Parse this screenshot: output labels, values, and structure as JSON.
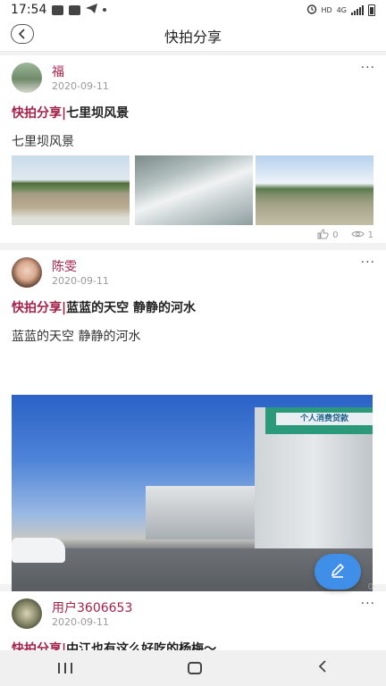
{
  "status_bar": {
    "time": "17:54",
    "network": "4G",
    "hd": "HD"
  },
  "header": {
    "title": "快拍分享"
  },
  "posts": [
    {
      "author": "福",
      "date": "2020-09-11",
      "tag": "快拍分享|",
      "title": "七里坝风景",
      "body": "七里坝风景",
      "likes": "0",
      "views": "1"
    },
    {
      "author": "陈雯",
      "date": "2020-09-11",
      "tag": "快拍分享|",
      "title": "蓝蓝的天空 静静的河水",
      "body": "蓝蓝的天空 静静的河水",
      "partial_count": "0",
      "photo_sign": "个人消费贷款"
    },
    {
      "author": "用户3606653",
      "date": "2020-09-11",
      "tag": "快拍分享|",
      "title": "中江也有这么好吃的杨梅～"
    }
  ],
  "colors": {
    "accent": "#a3224a",
    "fab": "#3f8ee8"
  }
}
